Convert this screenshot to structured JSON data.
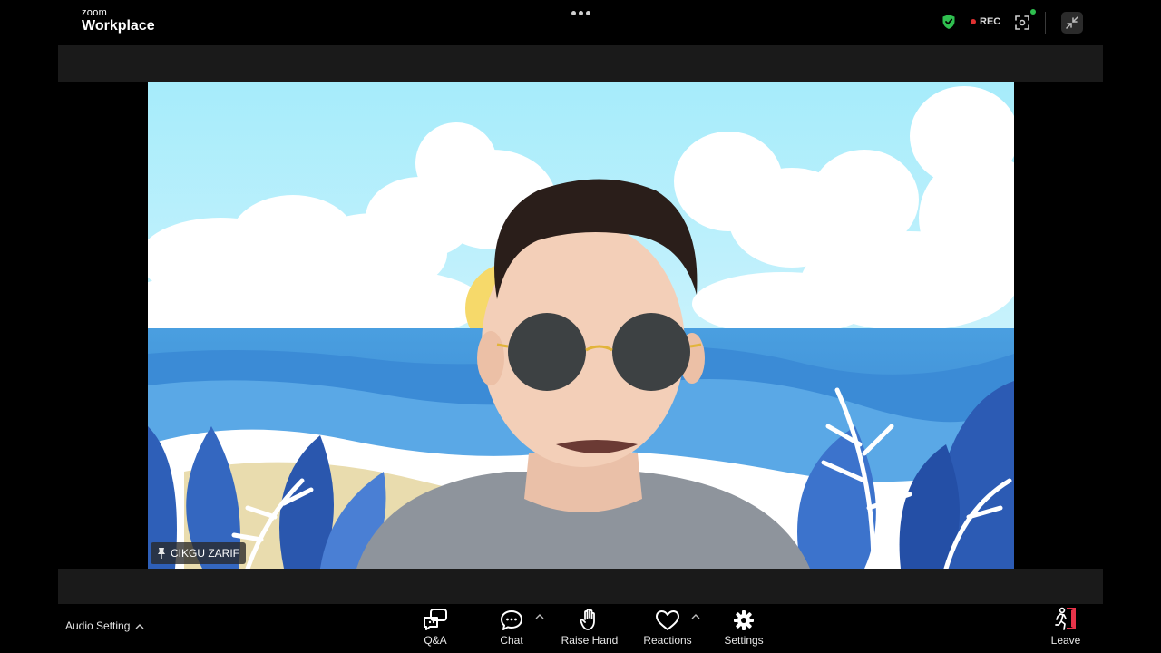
{
  "brand": {
    "small": "zoom",
    "big": "Workplace"
  },
  "top_bar": {
    "rec_label": "REC"
  },
  "participant": {
    "name": "CIKGU ZARIF"
  },
  "toolbar": {
    "audio_setting": "Audio Setting",
    "qa": "Q&A",
    "chat": "Chat",
    "raise_hand": "Raise Hand",
    "reactions": "Reactions",
    "settings": "Settings",
    "leave": "Leave"
  },
  "colors": {
    "background": "#000000",
    "strip": "#1a1a1a",
    "shield_green": "#2fbf4f",
    "rec_red": "#e03131",
    "leave_red": "#e8344a"
  },
  "icons": [
    "more-icon",
    "security-shield-icon",
    "rec-dot-icon",
    "view-icon",
    "exit-fullscreen-icon",
    "pin-icon",
    "chevron-up-icon",
    "qa-icon",
    "chat-icon",
    "raise-hand-icon",
    "heart-icon",
    "gear-icon",
    "leave-icon"
  ]
}
